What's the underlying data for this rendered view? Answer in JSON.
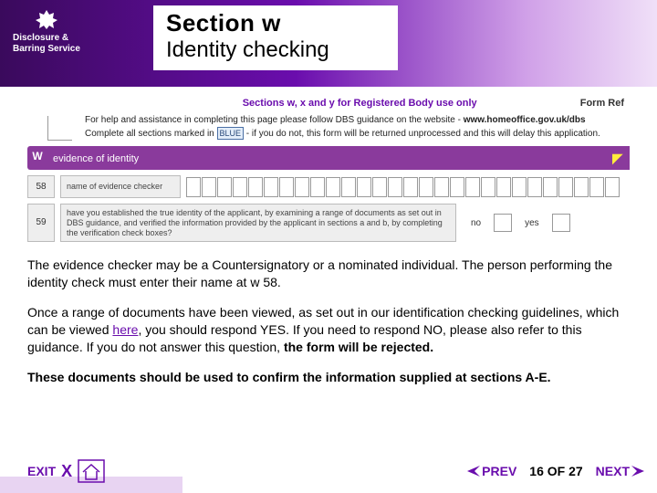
{
  "header": {
    "logo_line1": "Disclosure &",
    "logo_line2": "Barring Service",
    "title_main": "Section w",
    "title_sub": "Identity checking"
  },
  "scan": {
    "sect_label": "Sections w, x and y for Registered Body use only",
    "formref": "Form Ref",
    "instr1": "For help and assistance in completing this page please follow DBS guidance on the website - ",
    "instr1_url": "www.homeoffice.gov.uk/dbs",
    "instr2a": "Complete all sections marked in",
    "instr2_blue": "BLUE",
    "instr2b": " - if you do not, this form will be returned unprocessed and this will delay this application.",
    "w_tab": "W",
    "w_label": "evidence of identity",
    "row58_num": "58",
    "row58_label": "name of evidence checker",
    "row59_num": "59",
    "row59_label": "have you established the true identity of the applicant, by examining a range of documents as set out in DBS guidance, and verified the information provided by the applicant in sections a and b, by completing the verification check boxes?",
    "no": "no",
    "yes": "yes"
  },
  "body": {
    "p1": "The evidence checker may be a Countersignatory or a nominated individual.  The person performing the identity check must enter their name at w 58.",
    "p2a": "Once a range of documents have been viewed, as set out in our identification checking guidelines, which can be viewed ",
    "p2_link": "here",
    "p2b": ", you should respond YES.  If you need to respond NO, please also refer to this guidance.  If you do not answer this question, ",
    "p2c": "the form will be rejected.",
    "p3": "These documents should be used to confirm the information supplied at sections A-E."
  },
  "footer": {
    "exit": "EXIT",
    "x": "X",
    "prev": "PREV",
    "page": "16 OF 27",
    "next": "NEXT"
  }
}
